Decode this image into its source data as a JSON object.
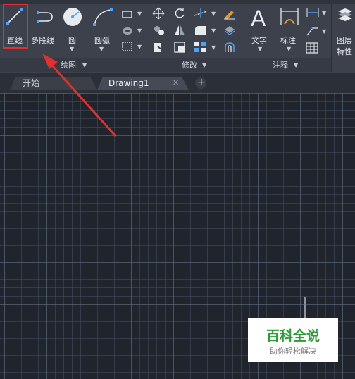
{
  "ribbon": {
    "draw_group": {
      "label": "绘图",
      "line_label": "直线",
      "polyline_label": "多段线",
      "circle_label": "圆",
      "arc_label": "圆弧"
    },
    "modify_group": {
      "label": "修改"
    },
    "annotation_group": {
      "label": "注释",
      "text_label": "文字",
      "dimension_label": "标注",
      "text_glyph": "A"
    },
    "layer_group": {
      "label_line1": "图层",
      "label_line2": "特性"
    }
  },
  "tabs": [
    {
      "label": "开始"
    },
    {
      "label": "Drawing1"
    }
  ],
  "tab_close": "✕",
  "tab_add": "+",
  "watermark": {
    "title": "百科全说",
    "subtitle": "助你轻松解决"
  },
  "colors": {
    "accent_red": "#e0312f",
    "ribbon_bg": "#3c414c",
    "canvas_bg": "#1f242d",
    "watermark_green": "#2c9c38"
  }
}
